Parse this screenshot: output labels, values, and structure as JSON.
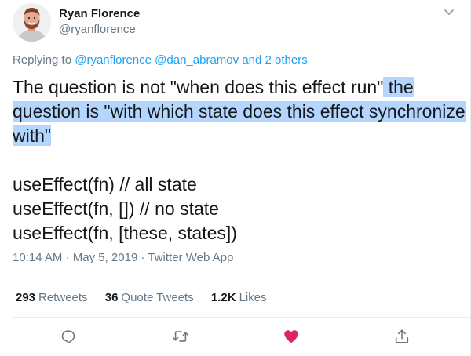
{
  "tweet": {
    "author": {
      "display_name": "Ryan Florence",
      "handle": "@ryanflorence"
    },
    "replying": {
      "prefix": "Replying to",
      "mention_1": "@ryanflorence",
      "mention_2": "@dan_abramov",
      "and_others": "and 2 others"
    },
    "text": {
      "line1_plain": "The question is not \"when does this effect run\"",
      "line1_highlight": " the",
      "line2_highlight": "question is \"with which state does this effect synchronize",
      "line3_highlight": "with\"",
      "code_1": "useEffect(fn) // all state",
      "code_2": "useEffect(fn, []) // no state",
      "code_3": "useEffect(fn, [these, states])"
    },
    "meta": {
      "time": "10:14 AM",
      "date": "May 5, 2019",
      "source": "Twitter Web App",
      "separator": "·"
    },
    "stats": {
      "retweets_count": "293",
      "retweets_label": "Retweets",
      "quotes_count": "36",
      "quotes_label": "Quote Tweets",
      "likes_count": "1.2K",
      "likes_label": "Likes"
    },
    "actions": {
      "reply_icon": "reply-icon",
      "retweet_icon": "retweet-icon",
      "like_icon": "like-icon",
      "share_icon": "share-icon"
    },
    "colors": {
      "link": "#1da1f2",
      "muted": "#657786",
      "highlight": "#b4d5fe",
      "like": "#e0245e"
    }
  }
}
